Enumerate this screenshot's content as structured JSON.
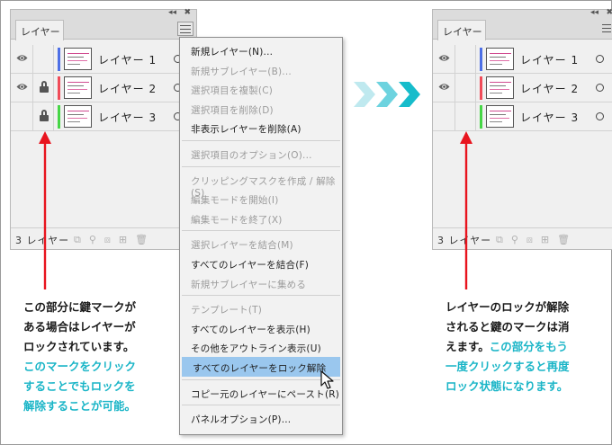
{
  "left_panel": {
    "tab_label": "レイヤー",
    "collapse_glyph": "◂◂",
    "close_glyph": "✖",
    "menu_icon": "hamburger-icon",
    "layers": [
      {
        "name": "レイヤー 1",
        "visible": true,
        "locked": false,
        "color": "#4d6fe6"
      },
      {
        "name": "レイヤー 2",
        "visible": true,
        "locked": true,
        "color": "#f04b58"
      },
      {
        "name": "レイヤー 3",
        "visible": false,
        "locked": true,
        "color": "#46d646"
      }
    ],
    "count_label": "3 レイヤー"
  },
  "right_panel": {
    "tab_label": "レイヤー",
    "collapse_glyph": "◂◂",
    "close_glyph": "✖",
    "layers": [
      {
        "name": "レイヤー 1",
        "visible": true,
        "locked": false,
        "color": "#4d6fe6"
      },
      {
        "name": "レイヤー 2",
        "visible": true,
        "locked": false,
        "color": "#f04b58"
      },
      {
        "name": "レイヤー 3",
        "visible": false,
        "locked": false,
        "color": "#46d646"
      }
    ],
    "count_label": "3 レイヤー"
  },
  "context_menu": {
    "items": [
      {
        "label": "新規レイヤー(N)...",
        "disabled": false,
        "highlighted": false
      },
      {
        "label": "新規サブレイヤー(B)...",
        "disabled": true,
        "highlighted": false
      },
      {
        "label": "選択項目を複製(C)",
        "disabled": true,
        "highlighted": false
      },
      {
        "label": "選択項目を削除(D)",
        "disabled": true,
        "highlighted": false
      },
      {
        "label": "非表示レイヤーを削除(A)",
        "disabled": false,
        "highlighted": false
      },
      {
        "label": "選択項目のオプション(O)...",
        "disabled": true,
        "highlighted": false
      },
      {
        "label": "クリッピングマスクを作成 / 解除(S)",
        "disabled": true,
        "highlighted": false
      },
      {
        "label": "編集モードを開始(I)",
        "disabled": true,
        "highlighted": false
      },
      {
        "label": "編集モードを終了(X)",
        "disabled": true,
        "highlighted": false
      },
      {
        "label": "選択レイヤーを結合(M)",
        "disabled": true,
        "highlighted": false
      },
      {
        "label": "すべてのレイヤーを結合(F)",
        "disabled": false,
        "highlighted": false
      },
      {
        "label": "新規サブレイヤーに集める",
        "disabled": true,
        "highlighted": false
      },
      {
        "label": "テンプレート(T)",
        "disabled": true,
        "highlighted": false
      },
      {
        "label": "すべてのレイヤーを表示(H)",
        "disabled": false,
        "highlighted": false
      },
      {
        "label": "その他をアウトライン表示(U)",
        "disabled": false,
        "highlighted": false
      },
      {
        "label": "すべてのレイヤーをロック解除",
        "disabled": false,
        "highlighted": true
      },
      {
        "label": "コピー元のレイヤーにペースト(R)",
        "disabled": false,
        "highlighted": false
      },
      {
        "label": "パネルオプション(P)...",
        "disabled": false,
        "highlighted": false
      }
    ]
  },
  "annotations": {
    "left": {
      "lines": [
        "この部分に鍵マークが",
        "ある場合はレイヤーが",
        "ロックされています。"
      ],
      "cyan_lines": [
        "このマークをクリック",
        "することでもロックを",
        "解除することが可能。"
      ]
    },
    "right": {
      "lines": [
        "レイヤーのロックが解除",
        "されると鍵のマークは消"
      ],
      "mixed_line": {
        "plain": "えます。",
        "cyan": "この部分をもう"
      },
      "cyan_lines": [
        "一度クリックすると再度",
        "ロック状態になります。"
      ]
    }
  },
  "colors": {
    "accent_cyan": "#1ab5c7",
    "arrow_red": "#e8141e",
    "menu_highlight": "#9ac7ee"
  }
}
